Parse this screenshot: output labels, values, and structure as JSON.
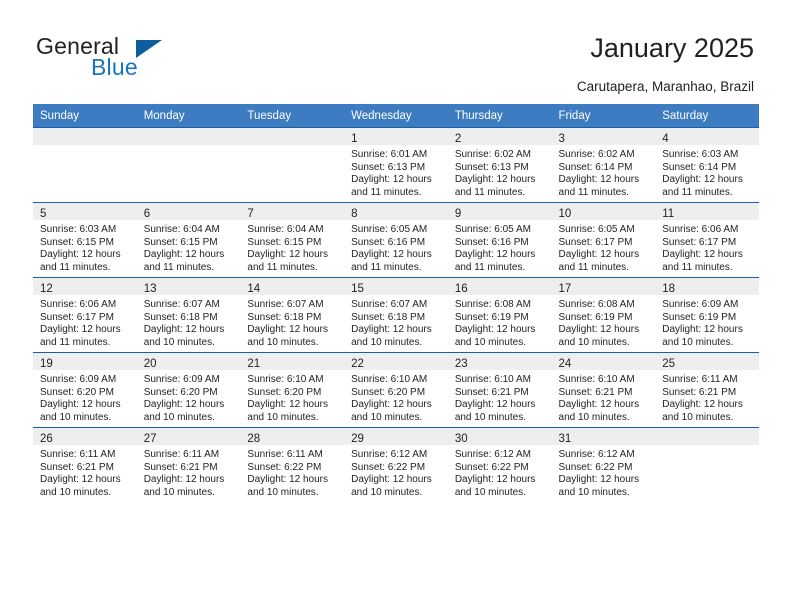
{
  "logo": {
    "word1": "General",
    "word2": "Blue",
    "triangle_color": "#0d5e9e",
    "blue_text_color": "#1b75bb"
  },
  "header": {
    "title": "January 2025",
    "location": "Carutapera, Maranhao, Brazil"
  },
  "theme": {
    "header_band": "#3d7cc0",
    "row_divider": "#1b5fa8",
    "daynum_band": "#eeeeee",
    "text": "#231f20"
  },
  "weekdays": [
    "Sunday",
    "Monday",
    "Tuesday",
    "Wednesday",
    "Thursday",
    "Friday",
    "Saturday"
  ],
  "weeks": [
    [
      {
        "day": "",
        "sunrise": "",
        "sunset": "",
        "daylight1": "",
        "daylight2": ""
      },
      {
        "day": "",
        "sunrise": "",
        "sunset": "",
        "daylight1": "",
        "daylight2": ""
      },
      {
        "day": "",
        "sunrise": "",
        "sunset": "",
        "daylight1": "",
        "daylight2": ""
      },
      {
        "day": "1",
        "sunrise": "Sunrise: 6:01 AM",
        "sunset": "Sunset: 6:13 PM",
        "daylight1": "Daylight: 12 hours",
        "daylight2": "and 11 minutes."
      },
      {
        "day": "2",
        "sunrise": "Sunrise: 6:02 AM",
        "sunset": "Sunset: 6:13 PM",
        "daylight1": "Daylight: 12 hours",
        "daylight2": "and 11 minutes."
      },
      {
        "day": "3",
        "sunrise": "Sunrise: 6:02 AM",
        "sunset": "Sunset: 6:14 PM",
        "daylight1": "Daylight: 12 hours",
        "daylight2": "and 11 minutes."
      },
      {
        "day": "4",
        "sunrise": "Sunrise: 6:03 AM",
        "sunset": "Sunset: 6:14 PM",
        "daylight1": "Daylight: 12 hours",
        "daylight2": "and 11 minutes."
      }
    ],
    [
      {
        "day": "5",
        "sunrise": "Sunrise: 6:03 AM",
        "sunset": "Sunset: 6:15 PM",
        "daylight1": "Daylight: 12 hours",
        "daylight2": "and 11 minutes."
      },
      {
        "day": "6",
        "sunrise": "Sunrise: 6:04 AM",
        "sunset": "Sunset: 6:15 PM",
        "daylight1": "Daylight: 12 hours",
        "daylight2": "and 11 minutes."
      },
      {
        "day": "7",
        "sunrise": "Sunrise: 6:04 AM",
        "sunset": "Sunset: 6:15 PM",
        "daylight1": "Daylight: 12 hours",
        "daylight2": "and 11 minutes."
      },
      {
        "day": "8",
        "sunrise": "Sunrise: 6:05 AM",
        "sunset": "Sunset: 6:16 PM",
        "daylight1": "Daylight: 12 hours",
        "daylight2": "and 11 minutes."
      },
      {
        "day": "9",
        "sunrise": "Sunrise: 6:05 AM",
        "sunset": "Sunset: 6:16 PM",
        "daylight1": "Daylight: 12 hours",
        "daylight2": "and 11 minutes."
      },
      {
        "day": "10",
        "sunrise": "Sunrise: 6:05 AM",
        "sunset": "Sunset: 6:17 PM",
        "daylight1": "Daylight: 12 hours",
        "daylight2": "and 11 minutes."
      },
      {
        "day": "11",
        "sunrise": "Sunrise: 6:06 AM",
        "sunset": "Sunset: 6:17 PM",
        "daylight1": "Daylight: 12 hours",
        "daylight2": "and 11 minutes."
      }
    ],
    [
      {
        "day": "12",
        "sunrise": "Sunrise: 6:06 AM",
        "sunset": "Sunset: 6:17 PM",
        "daylight1": "Daylight: 12 hours",
        "daylight2": "and 11 minutes."
      },
      {
        "day": "13",
        "sunrise": "Sunrise: 6:07 AM",
        "sunset": "Sunset: 6:18 PM",
        "daylight1": "Daylight: 12 hours",
        "daylight2": "and 10 minutes."
      },
      {
        "day": "14",
        "sunrise": "Sunrise: 6:07 AM",
        "sunset": "Sunset: 6:18 PM",
        "daylight1": "Daylight: 12 hours",
        "daylight2": "and 10 minutes."
      },
      {
        "day": "15",
        "sunrise": "Sunrise: 6:07 AM",
        "sunset": "Sunset: 6:18 PM",
        "daylight1": "Daylight: 12 hours",
        "daylight2": "and 10 minutes."
      },
      {
        "day": "16",
        "sunrise": "Sunrise: 6:08 AM",
        "sunset": "Sunset: 6:19 PM",
        "daylight1": "Daylight: 12 hours",
        "daylight2": "and 10 minutes."
      },
      {
        "day": "17",
        "sunrise": "Sunrise: 6:08 AM",
        "sunset": "Sunset: 6:19 PM",
        "daylight1": "Daylight: 12 hours",
        "daylight2": "and 10 minutes."
      },
      {
        "day": "18",
        "sunrise": "Sunrise: 6:09 AM",
        "sunset": "Sunset: 6:19 PM",
        "daylight1": "Daylight: 12 hours",
        "daylight2": "and 10 minutes."
      }
    ],
    [
      {
        "day": "19",
        "sunrise": "Sunrise: 6:09 AM",
        "sunset": "Sunset: 6:20 PM",
        "daylight1": "Daylight: 12 hours",
        "daylight2": "and 10 minutes."
      },
      {
        "day": "20",
        "sunrise": "Sunrise: 6:09 AM",
        "sunset": "Sunset: 6:20 PM",
        "daylight1": "Daylight: 12 hours",
        "daylight2": "and 10 minutes."
      },
      {
        "day": "21",
        "sunrise": "Sunrise: 6:10 AM",
        "sunset": "Sunset: 6:20 PM",
        "daylight1": "Daylight: 12 hours",
        "daylight2": "and 10 minutes."
      },
      {
        "day": "22",
        "sunrise": "Sunrise: 6:10 AM",
        "sunset": "Sunset: 6:20 PM",
        "daylight1": "Daylight: 12 hours",
        "daylight2": "and 10 minutes."
      },
      {
        "day": "23",
        "sunrise": "Sunrise: 6:10 AM",
        "sunset": "Sunset: 6:21 PM",
        "daylight1": "Daylight: 12 hours",
        "daylight2": "and 10 minutes."
      },
      {
        "day": "24",
        "sunrise": "Sunrise: 6:10 AM",
        "sunset": "Sunset: 6:21 PM",
        "daylight1": "Daylight: 12 hours",
        "daylight2": "and 10 minutes."
      },
      {
        "day": "25",
        "sunrise": "Sunrise: 6:11 AM",
        "sunset": "Sunset: 6:21 PM",
        "daylight1": "Daylight: 12 hours",
        "daylight2": "and 10 minutes."
      }
    ],
    [
      {
        "day": "26",
        "sunrise": "Sunrise: 6:11 AM",
        "sunset": "Sunset: 6:21 PM",
        "daylight1": "Daylight: 12 hours",
        "daylight2": "and 10 minutes."
      },
      {
        "day": "27",
        "sunrise": "Sunrise: 6:11 AM",
        "sunset": "Sunset: 6:21 PM",
        "daylight1": "Daylight: 12 hours",
        "daylight2": "and 10 minutes."
      },
      {
        "day": "28",
        "sunrise": "Sunrise: 6:11 AM",
        "sunset": "Sunset: 6:22 PM",
        "daylight1": "Daylight: 12 hours",
        "daylight2": "and 10 minutes."
      },
      {
        "day": "29",
        "sunrise": "Sunrise: 6:12 AM",
        "sunset": "Sunset: 6:22 PM",
        "daylight1": "Daylight: 12 hours",
        "daylight2": "and 10 minutes."
      },
      {
        "day": "30",
        "sunrise": "Sunrise: 6:12 AM",
        "sunset": "Sunset: 6:22 PM",
        "daylight1": "Daylight: 12 hours",
        "daylight2": "and 10 minutes."
      },
      {
        "day": "31",
        "sunrise": "Sunrise: 6:12 AM",
        "sunset": "Sunset: 6:22 PM",
        "daylight1": "Daylight: 12 hours",
        "daylight2": "and 10 minutes."
      },
      {
        "day": "",
        "sunrise": "",
        "sunset": "",
        "daylight1": "",
        "daylight2": ""
      }
    ]
  ]
}
